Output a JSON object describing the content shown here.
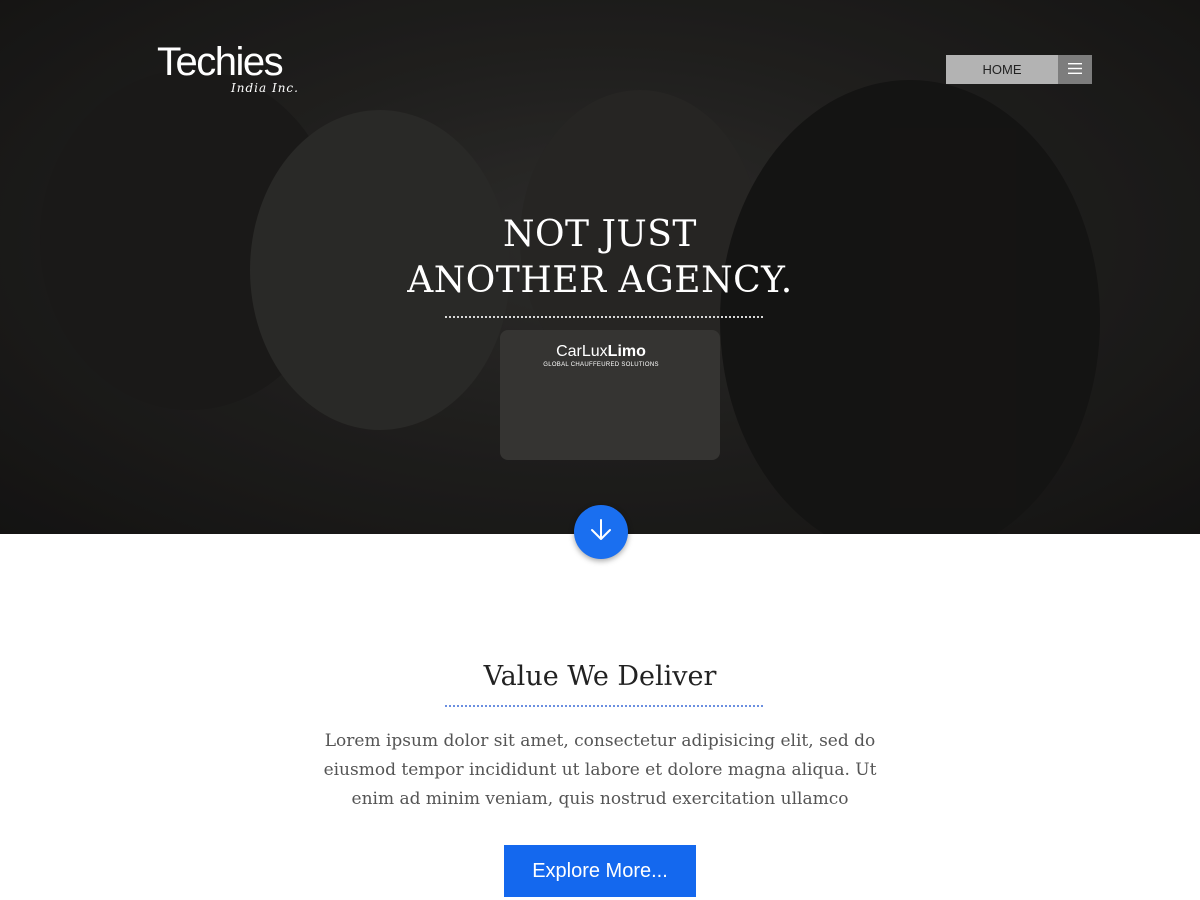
{
  "header": {
    "logo_main": "Techies",
    "logo_sub": "India Inc."
  },
  "nav": {
    "home_label": "HOME",
    "menu_icon": "hamburger-menu-icon"
  },
  "hero": {
    "headline_line1": "NOT JUST",
    "headline_line2": "ANOTHER AGENCY.",
    "client_name_light": "CarLux",
    "client_name_bold": "Limo",
    "client_tagline": "GLOBAL CHAUFFEURED SOLUTIONS",
    "scroll_icon": "arrow-down-icon"
  },
  "value": {
    "title": "Value We Deliver",
    "body": "Lorem ipsum dolor sit amet, consectetur adipisicing elit, sed do eiusmod tempor incididunt ut labore et dolore magna aliqua. Ut enim ad minim veniam, quis nostrud exercitation ullamco",
    "button_label": "Explore More..."
  },
  "colors": {
    "accent": "#1468ee",
    "hero_bg": "#2c2b29",
    "nav_home_bg": "#b3b3b3",
    "nav_menu_bg": "#7d7d7d"
  }
}
